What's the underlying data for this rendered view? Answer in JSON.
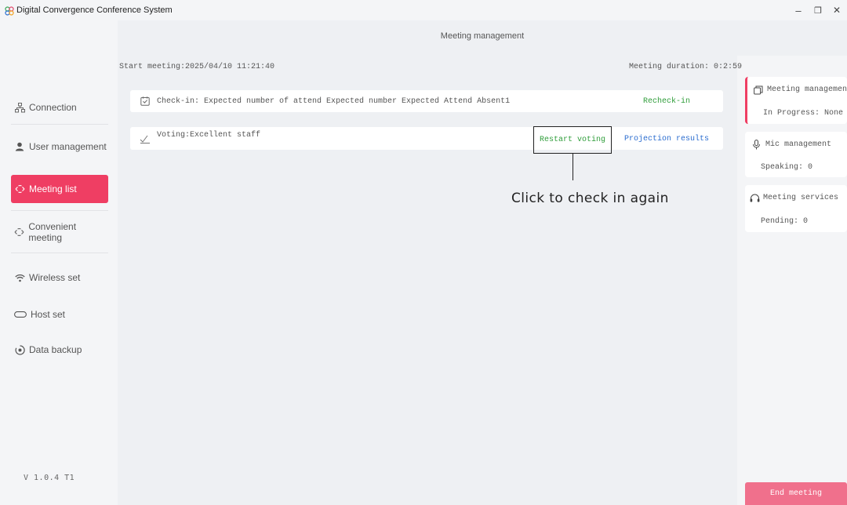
{
  "window": {
    "title": "Digital Convergence Conference System",
    "controls": {
      "minimize": "–",
      "restore": "❐",
      "close": "✕"
    }
  },
  "sidebar": {
    "items": [
      {
        "label": "Connection",
        "icon": "connection-icon"
      },
      {
        "label": "User management",
        "icon": "user-icon"
      },
      {
        "label": "Meeting list",
        "icon": "meeting-list-icon",
        "active": true
      },
      {
        "label": "Convenient meeting",
        "icon": "convenient-meeting-icon"
      },
      {
        "label": "Wireless set",
        "icon": "wifi-icon"
      },
      {
        "label": "Host set",
        "icon": "host-icon"
      },
      {
        "label": "Data backup",
        "icon": "backup-icon"
      }
    ],
    "version": "V 1.0.4 T1"
  },
  "header": {
    "title": "Meeting management",
    "start_meeting": "Start meeting:2025/04/10 11:21:40",
    "duration": "Meeting duration: 0:2:59"
  },
  "rows": {
    "checkin": {
      "text": "Check-in: Expected number of attend Expected number Expected Attend Absent1",
      "action": "Recheck-in"
    },
    "voting": {
      "text": "Voting:Excellent staff",
      "restart": "Restart voting",
      "projection": "Projection results"
    }
  },
  "annotation": {
    "text": "Click to check in again"
  },
  "right_panel": {
    "meeting_management": {
      "title": "Meeting management",
      "value": "In Progress: None"
    },
    "mic_management": {
      "title": "Mic management",
      "value": "Speaking: 0"
    },
    "meeting_services": {
      "title": "Meeting services",
      "value": "Pending: 0"
    },
    "end_button": "End meeting"
  },
  "colors": {
    "accent": "#ef3e63",
    "link_green": "#2f9d3a",
    "link_blue": "#2a6ccf"
  }
}
